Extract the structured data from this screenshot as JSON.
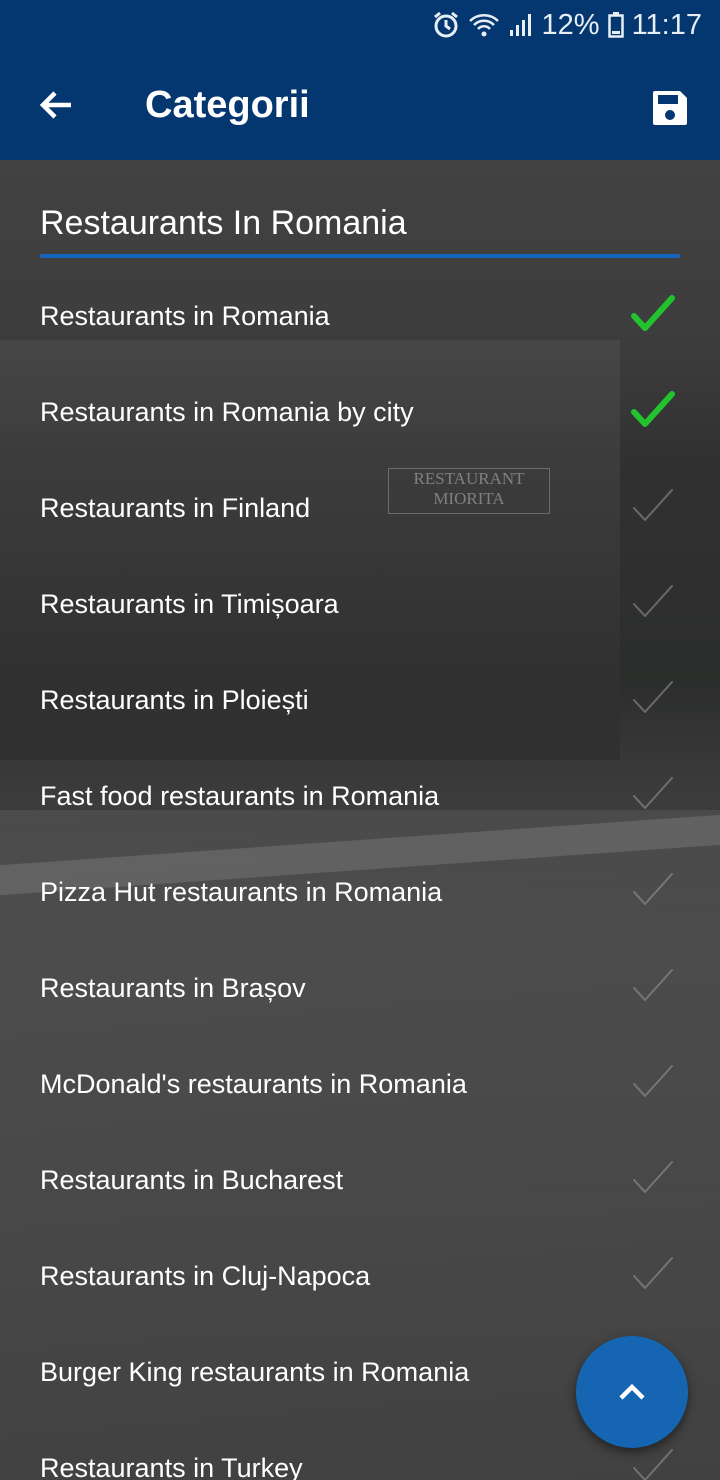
{
  "status_bar": {
    "battery_percent": "12%",
    "time": "11:17",
    "icons": [
      "alarm-icon",
      "wifi-icon",
      "signal-icon",
      "battery-icon"
    ]
  },
  "app_bar": {
    "title": "Categorii",
    "back_icon": "arrow-left-icon",
    "save_icon": "save-icon"
  },
  "search": {
    "value": "Restaurants In Romania"
  },
  "categories": [
    {
      "label": "Restaurants in Romania",
      "checked": true
    },
    {
      "label": "Restaurants in Romania by city",
      "checked": true
    },
    {
      "label": "Restaurants in Finland",
      "checked": false
    },
    {
      "label": "Restaurants in Timișoara",
      "checked": false
    },
    {
      "label": "Restaurants in Ploiești",
      "checked": false
    },
    {
      "label": "Fast food restaurants in Romania",
      "checked": false
    },
    {
      "label": "Pizza Hut restaurants in Romania",
      "checked": false
    },
    {
      "label": "Restaurants in Brașov",
      "checked": false
    },
    {
      "label": "McDonald's restaurants in Romania",
      "checked": false
    },
    {
      "label": "Restaurants in Bucharest",
      "checked": false
    },
    {
      "label": "Restaurants in Cluj-Napoca",
      "checked": false
    },
    {
      "label": "Burger King restaurants in Romania",
      "checked": false
    },
    {
      "label": "Restaurants in Turkey",
      "checked": false
    }
  ],
  "background_sign": "RESTAURANT MIORITA",
  "fab": {
    "icon": "chevron-up-icon"
  },
  "colors": {
    "app_bar": "#04376f",
    "accent": "#1565c0",
    "check_on": "#22c32e",
    "check_off": "#9a9a9a"
  }
}
